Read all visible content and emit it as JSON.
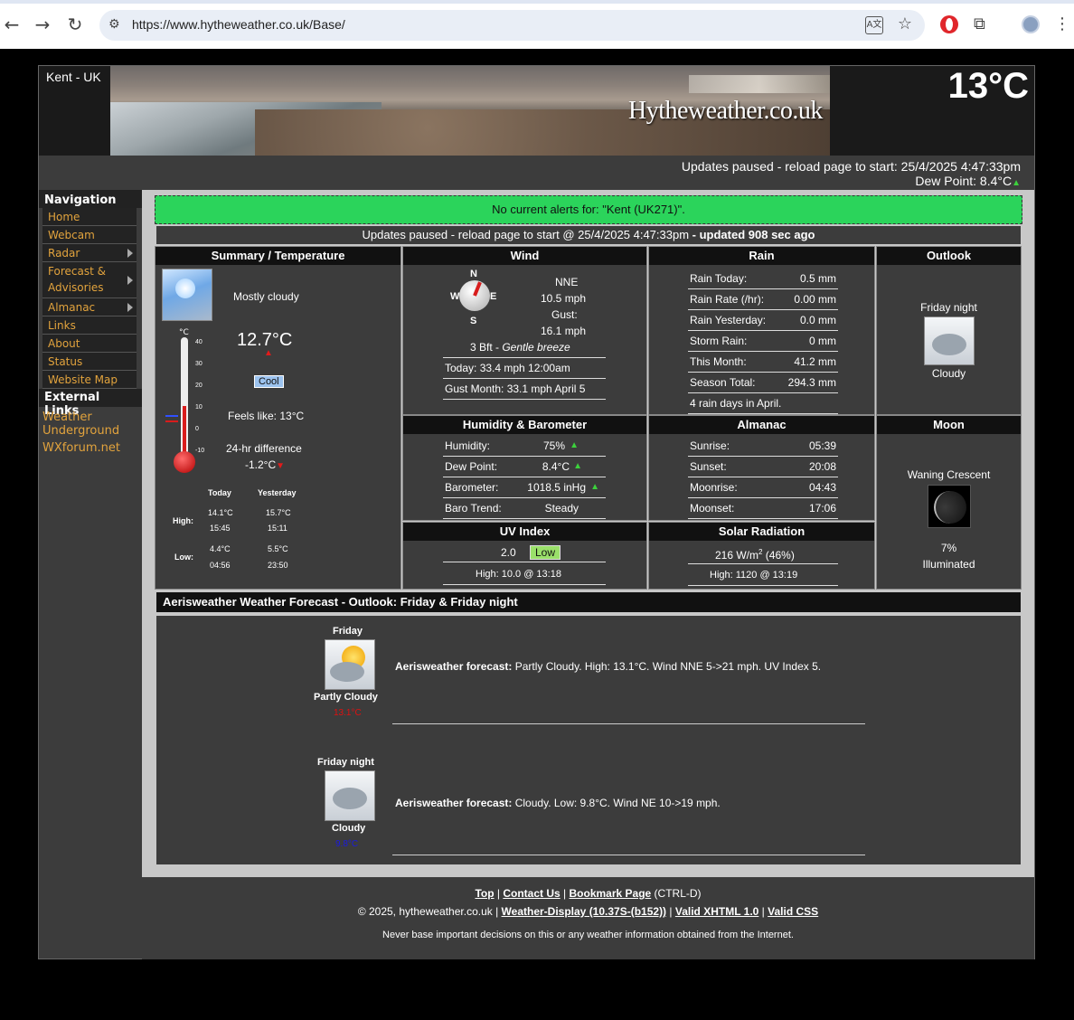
{
  "browser": {
    "url": "https://www.hytheweather.co.uk/Base/",
    "nav_back": "←",
    "nav_forward": "→",
    "nav_reload": "↻"
  },
  "header": {
    "region": "Kent - UK",
    "logo": "Hytheweather.co.uk",
    "current_temp": "13°C",
    "status_line": "Updates paused - reload page to start:  25/4/2025  4:47:33pm",
    "dew_point": "Dew Point: 8.4°C"
  },
  "sidebar": {
    "title": "Navigation",
    "items": [
      {
        "label": "Home"
      },
      {
        "label": "Webcam"
      },
      {
        "label": "Radar"
      },
      {
        "label": "Forecast &"
      },
      {
        "label": "Advisories"
      },
      {
        "label": "Almanac"
      },
      {
        "label": "Links"
      },
      {
        "label": "About"
      },
      {
        "label": "Status"
      },
      {
        "label": "Website Map"
      }
    ],
    "external_title": "External Links",
    "external": [
      {
        "label": "Weather"
      },
      {
        "label": "Underground"
      },
      {
        "label": "WXforum.net"
      }
    ]
  },
  "alert": "No current alerts for: \"Kent (UK271)\".",
  "update_line": "Updates paused - reload page to start @ 25/4/2025 4:47:33pm",
  "update_suffix": "- updated 908 sec ago",
  "summary": {
    "title": "Summary / Temperature",
    "condition": "Mostly cloudy",
    "temp": "12.7°C",
    "feel_badge": "Cool",
    "feels_like": "Feels like: 13°C",
    "diff_label": "24-hr difference",
    "diff_value": "-1.2°C",
    "therm_unit": "°C",
    "therm_ticks": [
      "40",
      "30",
      "20",
      "10",
      "0",
      "-10"
    ],
    "therm_level": 0.42,
    "hl_today": "Today",
    "hl_yesterday": "Yesterday",
    "high_label": "High:",
    "low_label": "Low:",
    "today_high": "14.1°C",
    "today_high_time": "15:45",
    "yest_high": "15.7°C",
    "yest_high_time": "15:11",
    "today_low": "4.4°C",
    "today_low_time": "04:56",
    "yest_low": "5.5°C",
    "yest_low_time": "23:50"
  },
  "wind": {
    "title": "Wind",
    "dir": "NNE",
    "speed": "10.5 mph",
    "gust_label": "Gust:",
    "gust": "16.1 mph",
    "bft": "3 Bft - ",
    "bft_desc": "Gentle breeze",
    "today": "Today: 33.4 mph 12:00am",
    "gust_month": "Gust Month: 33.1 mph April 5",
    "compass": {
      "n": "N",
      "e": "E",
      "s": "S",
      "w": "W"
    }
  },
  "rain": {
    "title": "Rain",
    "rows": [
      {
        "k": "Rain Today:",
        "v": "0.5 mm"
      },
      {
        "k": "Rain Rate (/hr):",
        "v": "0.00 mm"
      },
      {
        "k": "Rain Yesterday:",
        "v": "0.0 mm"
      },
      {
        "k": "Storm Rain:",
        "v": "0 mm"
      },
      {
        "k": "This Month:",
        "v": "41.2 mm"
      },
      {
        "k": "Season Total:",
        "v": "294.3 mm"
      }
    ],
    "days": "4 rain days in April."
  },
  "outlook": {
    "title": "Outlook",
    "period": "Friday night",
    "cond": "Cloudy"
  },
  "humidity": {
    "title": "Humidity & Barometer",
    "rows": [
      {
        "k": "Humidity:",
        "v": "75%"
      },
      {
        "k": "Dew Point:",
        "v": "8.4°C"
      },
      {
        "k": "Barometer:",
        "v": "1018.5 inHg"
      },
      {
        "k": "Baro Trend:",
        "v": "Steady"
      }
    ]
  },
  "almanac": {
    "title": "Almanac",
    "rows": [
      {
        "k": "Sunrise:",
        "v": "05:39"
      },
      {
        "k": "Sunset:",
        "v": "20:08"
      },
      {
        "k": "Moonrise:",
        "v": "04:43"
      },
      {
        "k": "Moonset:",
        "v": "17:06"
      }
    ]
  },
  "moon": {
    "title": "Moon",
    "phase": "Waning Crescent",
    "pct": "7%",
    "illum": "Illuminated"
  },
  "uv": {
    "title": "UV Index",
    "value": "2.0",
    "level": "Low",
    "high": "High: 10.0 @ 13:18"
  },
  "solar": {
    "title": "Solar Radiation",
    "value": "216 W/m",
    "sup": "2",
    "pct": " (46%)",
    "high": "High: 1120 @  13:19"
  },
  "forecast": {
    "title": "Aerisweather Weather Forecast  - Outlook: Friday & Friday night",
    "items": [
      {
        "period": "Friday",
        "cond": "Partly Cloudy",
        "temp": "13.1°C",
        "label": "Aerisweather forecast:",
        "text": " Partly Cloudy. High: 13.1°C. Wind NNE 5->21 mph. UV Index 5.",
        "temp_color": "#e01010"
      },
      {
        "period": "Friday night",
        "cond": "Cloudy",
        "temp": "9.8°C",
        "label": "Aerisweather forecast:",
        "text": " Cloudy. Low: 9.8°C. Wind NE 10->19 mph.",
        "temp_color": "#1a1ae0"
      }
    ]
  },
  "footer": {
    "top": "Top",
    "sep": " | ",
    "contact": "Contact Us",
    "bookmark": "Bookmark Page",
    "ctrl": " (CTRL-D)",
    "copyright": "© 2025, hytheweather.co.uk | ",
    "wd": "Weather-Display (10.37S-(b152))",
    "xhtml": "Valid XHTML 1.0",
    "css": "Valid CSS",
    "disclaimer": "Never base important decisions on this or any weather information obtained from the Internet."
  }
}
